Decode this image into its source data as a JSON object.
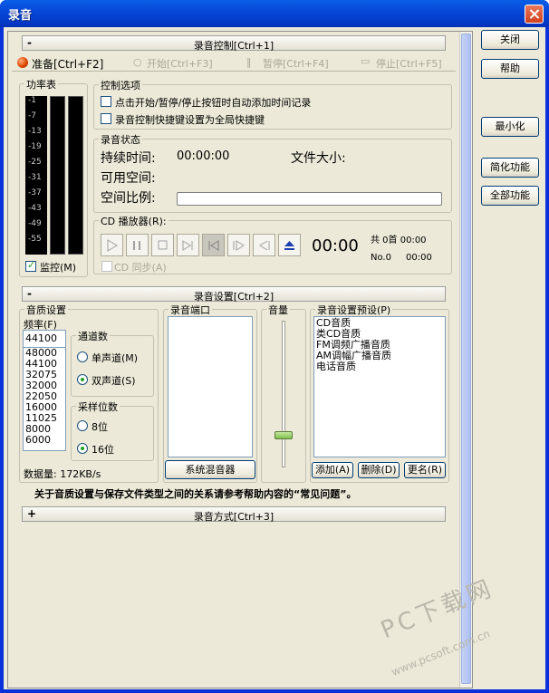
{
  "window": {
    "title": "录音"
  },
  "sidebar": {
    "close": "关闭",
    "help": "帮助",
    "minimize": "最小化",
    "simple": "简化功能",
    "full": "全部功能"
  },
  "control": {
    "header": "录音控制[Ctrl+1]",
    "header_sign": "-",
    "ready": "准备[Ctrl+F2]",
    "start": "开始[Ctrl+F3]",
    "pause": "暂停[Ctrl+F4]",
    "stop": "停止[Ctrl+F5]",
    "meter_title": "功率表",
    "meter_ticks": [
      "-1",
      "-7",
      "-13",
      "-19",
      "-25",
      "-31",
      "-37",
      "-43",
      "-49",
      "-55"
    ],
    "monitor_label": "监控(M)",
    "monitor_checked": true,
    "options_title": "控制选项",
    "opt1": "点击开始/暂停/停止按钮时自动添加时间记录",
    "opt2": "录音控制快捷键设置为全局快捷键",
    "status_title": "录音状态",
    "duration_label": "持续时间:",
    "duration_value": "00:00:00",
    "filesize_label": "文件大小:",
    "free_label": "可用空间:",
    "ratio_label": "空间比例:",
    "cd_title": "CD 播放器(R):",
    "cd_time": "00:00",
    "cd_total": "共 0首 00:00",
    "cd_no": "No.0",
    "cd_no_time": "00:00",
    "cd_sync": "CD 同步(A)"
  },
  "settings": {
    "header": "录音设置[Ctrl+2]",
    "header_sign": "-",
    "quality_title": "音质设置",
    "freq_label": "频率(F)",
    "freq_value": "44100",
    "freq_options": [
      "48000",
      "44100",
      "32075",
      "32000",
      "22050",
      "16000",
      "11025",
      "8000",
      "6000"
    ],
    "channels_title": "通道数",
    "mono": "单声道(M)",
    "stereo": "双声道(S)",
    "bits_title": "采样位数",
    "bits8": "8位",
    "bits16": "16位",
    "datarate": "数据量: 172KB/s",
    "port_title": "录音端口",
    "mixer_btn": "系统混音器",
    "volume_title": "音量",
    "volume_level": 0.2,
    "preset_title": "录音设置预设(P)",
    "presets": [
      "CD音质",
      "类CD音质",
      "FM调频广播音质",
      "AM调幅广播音质",
      "电话音质"
    ],
    "add_btn": "添加(A)",
    "delete_btn": "删除(D)",
    "rename_btn": "更名(R)",
    "note": "关于音质设置与保存文件类型之间的关系请参考帮助内容的“常见问题”。"
  },
  "mode": {
    "header": "录音方式[Ctrl+3]",
    "header_sign": "+"
  },
  "watermark": {
    "brand": "PC下载网",
    "url": "www.pcsoft.com.cn"
  }
}
